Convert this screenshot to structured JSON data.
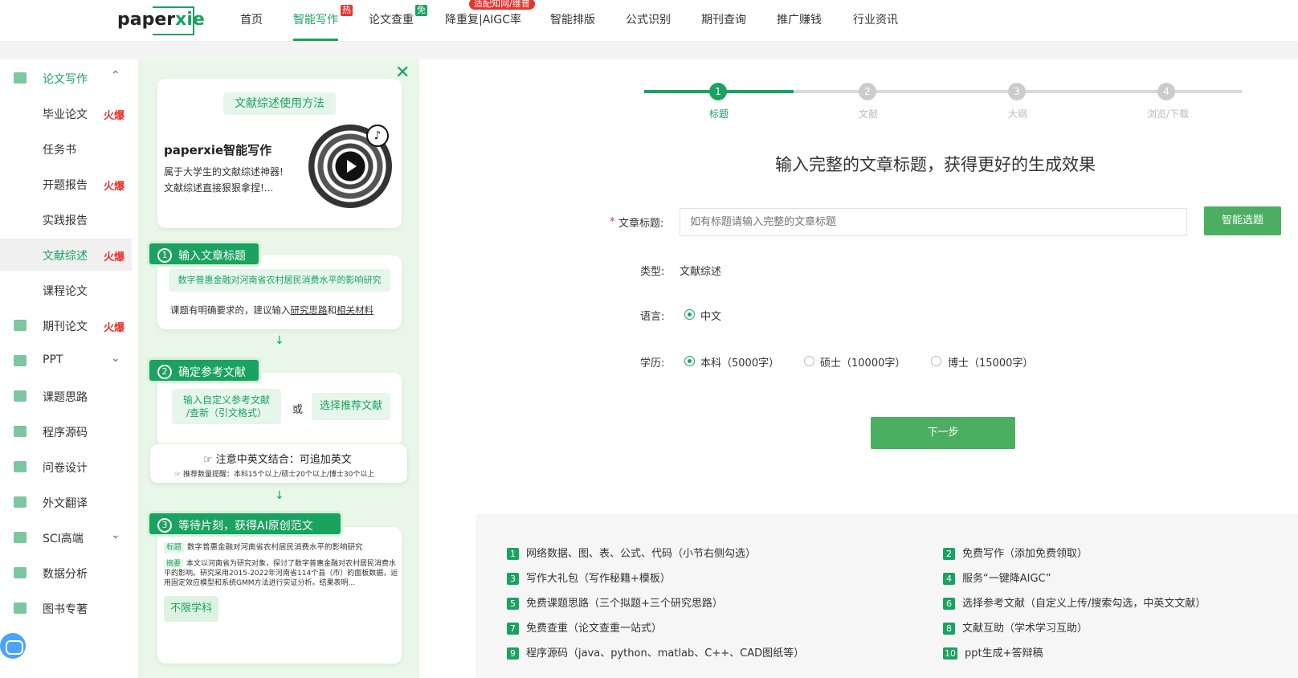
{
  "colors": {
    "brand": "#1aa260",
    "hot": "#e7332c",
    "panel": "#e8f7e8"
  },
  "header": {
    "logo_text_prefix": "paper",
    "logo_text_suffix": "xie",
    "nav": [
      {
        "label": "首页"
      },
      {
        "label": "智能写作",
        "badge": "热"
      },
      {
        "label": "论文查重",
        "badge": "免"
      },
      {
        "label": "降重复|AIGC率",
        "badge": "适配知网/维普"
      },
      {
        "label": "智能排版"
      },
      {
        "label": "公式识别"
      },
      {
        "label": "期刊查询"
      },
      {
        "label": "推广赚钱"
      },
      {
        "label": "行业资讯"
      }
    ]
  },
  "sidebar": {
    "items": [
      {
        "label": "论文写作",
        "icon": "edit-icon",
        "chevron": "up"
      },
      {
        "label": "毕业论文",
        "hot": "火爆"
      },
      {
        "label": "任务书"
      },
      {
        "label": "开题报告",
        "hot": "火爆"
      },
      {
        "label": "实践报告"
      },
      {
        "label": "文献综述",
        "hot": "火爆",
        "active": true
      },
      {
        "label": "课程论文"
      },
      {
        "label": "期刊论文",
        "hot": "火爆",
        "icon": "journal-icon"
      },
      {
        "label": "PPT",
        "icon": "ppt-icon",
        "chevron": "down"
      },
      {
        "label": "课题思路",
        "icon": "idea-icon"
      },
      {
        "label": "程序源码",
        "icon": "code-icon"
      },
      {
        "label": "问卷设计",
        "icon": "survey-icon"
      },
      {
        "label": "外文翻译",
        "icon": "translate-icon"
      },
      {
        "label": "SCI高端",
        "icon": "sci-icon",
        "chevron": "down"
      },
      {
        "label": "数据分析",
        "icon": "chart-icon"
      },
      {
        "label": "图书专著",
        "icon": "book-icon"
      }
    ]
  },
  "tutorial": {
    "header_pill": "文献综述使用方法",
    "brand_title": "paperxie智能写作",
    "brand_desc_1": "属于大学生的文献综述神器!",
    "brand_desc_2": "文献综述直接狠狠拿捏!...",
    "step1": {
      "num": "1",
      "title": "输入文章标题",
      "example": "数字普惠金融对河南省农村居民消费水平的影响研究",
      "hint_a": "课题有明确要求的，建议输入",
      "hint_b": "研究思路",
      "hint_c": "和",
      "hint_d": "相关材料"
    },
    "step2": {
      "num": "2",
      "title": "确定参考文献",
      "opt1_line1": "输入自定义参考文献",
      "opt1_line2": "/查新（引文格式）",
      "or": "或",
      "opt2": "选择推荐文献",
      "note_title": "注意中英文结合：可追加英文",
      "note_sub": "推荐数量提醒：本科15个以上/硕士20个以上/博士30个以上"
    },
    "step3": {
      "num": "3",
      "title": "等待片刻，获得AI原创范文",
      "title_tag": "标题",
      "title_text": "数字普惠金融对河南省农村居民消费水平的影响研究",
      "abstract_tag": "摘要",
      "abstract_text": "本文以河南省为研究对象，探讨了数字普惠金融对农村居民消费水平的影响。研究采用2015-2022年河南省114个县（市）的面板数据，运用固定效应模型和系统GMM方法进行实证分析。结果表明...",
      "unlimited": "不限学科"
    }
  },
  "form": {
    "progress": {
      "current": 1,
      "total": 4
    },
    "steps": [
      {
        "num": "1",
        "label": "标题"
      },
      {
        "num": "2",
        "label": "文献"
      },
      {
        "num": "3",
        "label": "大纲"
      },
      {
        "num": "4",
        "label": "浏览/下载"
      }
    ],
    "headline": "输入完整的文章标题，获得更好的生成效果",
    "title_required": "*",
    "title_label": "文章标题:",
    "title_placeholder": "如有标题请输入完整的文章标题",
    "smart_topic_btn": "智能选题",
    "type_label": "类型:",
    "type_value": "文献综述",
    "lang_label": "语言:",
    "lang_options": [
      {
        "label": "中文",
        "selected": true
      }
    ],
    "edu_label": "学历:",
    "edu_options": [
      {
        "label": "本科（5000字）",
        "selected": true
      },
      {
        "label": "硕士（10000字）",
        "selected": false
      },
      {
        "label": "博士（15000字）",
        "selected": false
      }
    ],
    "next_btn": "下一步"
  },
  "features": [
    {
      "n": "1",
      "text": "网络数据、图、表、公式、代码（小节右侧勾选）"
    },
    {
      "n": "2",
      "text": "免费写作（添加免费领取）"
    },
    {
      "n": "3",
      "text": "写作大礼包（写作秘籍+模板）"
    },
    {
      "n": "4",
      "text": "服务“一键降AIGC”"
    },
    {
      "n": "5",
      "text": "免费课题思路（三个拟题+三个研究思路）"
    },
    {
      "n": "6",
      "text": "选择参考文献（自定义上传/搜索勾选，中英文文献）"
    },
    {
      "n": "7",
      "text": "免费查重（论文查重一站式）"
    },
    {
      "n": "8",
      "text": "文献互助（学术学习互助）"
    },
    {
      "n": "9",
      "text": "程序源码（java、python、matlab、C++、CAD图纸等）"
    },
    {
      "n": "10",
      "text": "ppt生成+答辩稿"
    }
  ]
}
